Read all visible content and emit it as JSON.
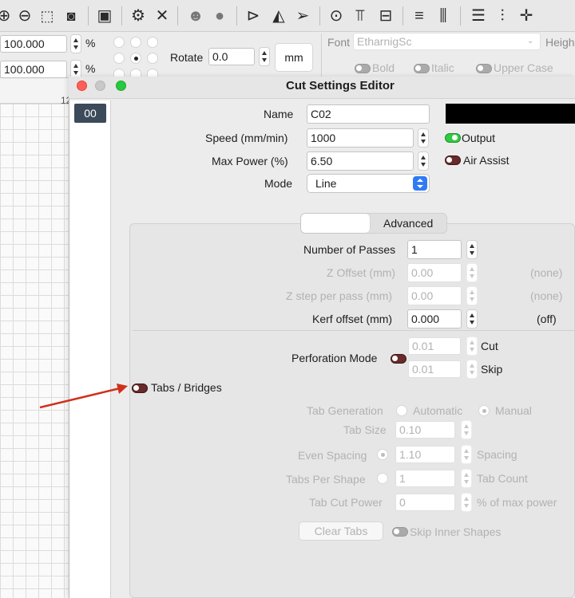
{
  "toolbar": {
    "icons": [
      "zoom-in-icon",
      "zoom-out-icon",
      "select-frame-icon",
      "camera-icon",
      "monitor-icon",
      "settings-gear-icon",
      "tools-icon",
      "users-icon",
      "user-icon",
      "send-icon",
      "mirror-icon",
      "paper-plane-icon",
      "target-icon",
      "align-top-icon",
      "distribute-icon",
      "align-h-icon",
      "align-v-icon",
      "layout-icon",
      "align-center-icon",
      "crosshair-icon"
    ]
  },
  "options": {
    "width_value": "100.000",
    "height_value": "100.000",
    "percent": "%",
    "rotate_label": "Rotate",
    "rotate_value": "0.0",
    "unit_button": "mm",
    "font_label": "Font",
    "font_value": "EtharnigSc",
    "height_label": "Heigh",
    "bold": "Bold",
    "italic": "Italic",
    "upper_case": "Upper Case",
    "ruler_mark": "12"
  },
  "window": {
    "title": "Cut Settings Editor",
    "layer": "00",
    "name_label": "Name",
    "name_value": "C02",
    "speed_label": "Speed (mm/min)",
    "speed_value": "1000",
    "power_label": "Max Power (%)",
    "power_value": "6.50",
    "mode_label": "Mode",
    "mode_value": "Line",
    "output_label": "Output",
    "air_assist_label": "Air Assist",
    "layer_color": "#000000"
  },
  "tabs": {
    "blank": "",
    "advanced": "Advanced"
  },
  "advanced": {
    "passes_label": "Number of Passes",
    "passes_value": "1",
    "zoffset_label": "Z Offset (mm)",
    "zoffset_value": "0.00",
    "zoffset_note": "(none)",
    "zstep_label": "Z step per pass (mm)",
    "zstep_value": "0.00",
    "zstep_note": "(none)",
    "kerf_label": "Kerf offset (mm)",
    "kerf_value": "0.000",
    "kerf_note": "(off)",
    "perf_label": "Perforation Mode",
    "cut_value": "0.01",
    "cut_label": "Cut",
    "skip_value": "0.01",
    "skip_label": "Skip"
  },
  "tabsbridges": {
    "label": "Tabs / Bridges",
    "gen_label": "Tab Generation",
    "automatic": "Automatic",
    "manual": "Manual",
    "size_label": "Tab Size",
    "size_value": "0.10",
    "even_label": "Even Spacing",
    "even_value": "1.10",
    "spacing_label": "Spacing",
    "per_shape_label": "Tabs Per Shape",
    "per_shape_value": "1",
    "count_label": "Tab Count",
    "power_label": "Tab Cut Power",
    "power_value": "0",
    "power_unit": "% of max power",
    "clear_button": "Clear Tabs",
    "skip_inner": "Skip Inner Shapes"
  },
  "colors": {
    "arrow": "#d0301a",
    "output_toggle": "#2ecc40",
    "off_toggle": "#6a2a2a"
  }
}
